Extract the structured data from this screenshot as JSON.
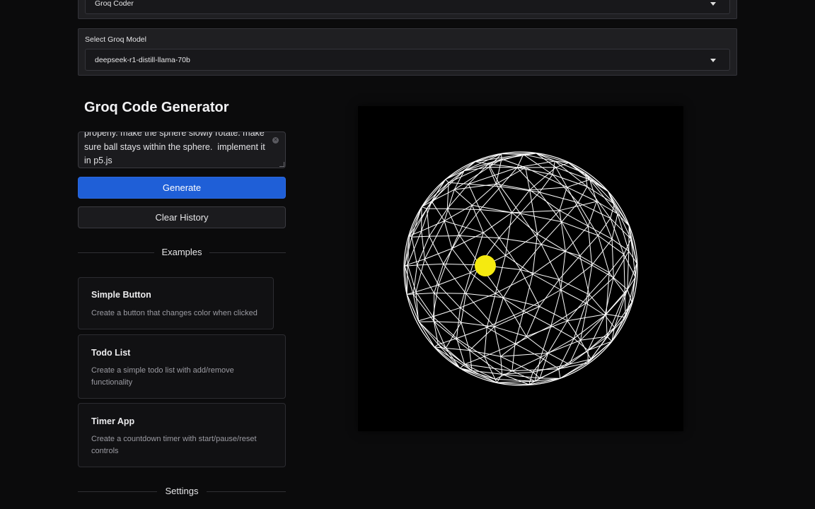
{
  "header": {
    "app_select_value": "Groq Coder"
  },
  "model_panel": {
    "label": "Select Groq Model",
    "selected_model": "deepseek-r1-distill-llama-70b"
  },
  "main": {
    "title": "Groq Code Generator",
    "prompt_text": "properly. make the sphere slowly rotate. make sure ball stays within the sphere.  implement it in p5.js",
    "generate_label": "Generate",
    "clear_history_label": "Clear History",
    "examples_heading": "Examples",
    "settings_heading": "Settings",
    "examples": [
      {
        "title": "Simple Button",
        "description": "Create a button that changes color when clicked"
      },
      {
        "title": "Todo List",
        "description": "Create a simple todo list with add/remove functionality"
      },
      {
        "title": "Timer App",
        "description": "Create a countdown timer with start/pause/reset controls"
      }
    ]
  },
  "preview": {
    "sphere_color": "#ffffff",
    "ball_color": "#f5ea10",
    "background_color": "#000000"
  },
  "colors": {
    "accent": "#1f5fd7",
    "page_bg": "#0b0b0c"
  },
  "icons": {
    "dropdown": "caret-down-icon",
    "clear": "clear-circle-icon"
  }
}
